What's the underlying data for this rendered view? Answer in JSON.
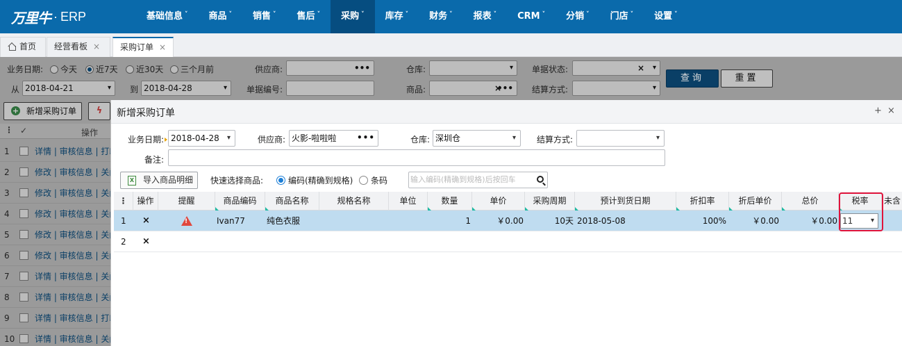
{
  "app": {
    "logo_mark": "万里牛",
    "logo_dot": "·",
    "logo_text": "ERP"
  },
  "nav": [
    {
      "label": "基础信息",
      "active": false
    },
    {
      "label": "商品",
      "active": false
    },
    {
      "label": "销售",
      "active": false
    },
    {
      "label": "售后",
      "active": false
    },
    {
      "label": "采购",
      "active": true
    },
    {
      "label": "库存",
      "active": false
    },
    {
      "label": "财务",
      "active": false
    },
    {
      "label": "报表",
      "active": false
    },
    {
      "label": "CRM",
      "active": false
    },
    {
      "label": "分销",
      "active": false
    },
    {
      "label": "门店",
      "active": false
    },
    {
      "label": "设置",
      "active": false
    }
  ],
  "tabs": {
    "home": "首页",
    "dashboard": "经营看板",
    "purchase_order": "采购订单",
    "close": "×"
  },
  "filter": {
    "biz_date_label": "业务日期:",
    "today": "今天",
    "last7": "近7天",
    "last30": "近30天",
    "last3m": "三个月前",
    "from_label": "从",
    "from_value": "2018-04-21",
    "to_label": "到",
    "to_value": "2018-04-28",
    "supplier_label": "供应商:",
    "doc_no_label": "单据编号:",
    "warehouse_label": "仓库:",
    "product_label": "商品:",
    "status_label": "单据状态:",
    "settle_label": "结算方式:",
    "search_btn": "查询",
    "reset_btn": "重置"
  },
  "bg_list": {
    "new_order_btn": "新增采购订单",
    "ops_header": "操作",
    "rows": [
      {
        "num": "1",
        "ops": "详情 | 审核信息 | 打印"
      },
      {
        "num": "2",
        "ops": "修改 | 审核信息 | 关闭"
      },
      {
        "num": "3",
        "ops": "修改 | 审核信息 | 关闭"
      },
      {
        "num": "4",
        "ops": "修改 | 审核信息 | 关闭"
      },
      {
        "num": "5",
        "ops": "修改 | 审核信息 | 关闭"
      },
      {
        "num": "6",
        "ops": "修改 | 审核信息 | 关闭"
      },
      {
        "num": "7",
        "ops": "详情 | 审核信息 | 关闭"
      },
      {
        "num": "8",
        "ops": "详情 | 审核信息 | 关闭"
      },
      {
        "num": "9",
        "ops": "详情 | 审核信息 | 打印"
      },
      {
        "num": "10",
        "ops": "详情 | 审核信息 | 关闭"
      }
    ]
  },
  "modal": {
    "title": "新增采购订单",
    "ctrl_plus": "+",
    "ctrl_close": "×",
    "biz_date_label": "业务日期:",
    "biz_date_value": "2018-04-28",
    "supplier_label": "供应商:",
    "supplier_value": "火影-啦啦啦",
    "warehouse_label": "仓库:",
    "warehouse_value": "深圳仓",
    "settle_label": "结算方式:",
    "remark_label": "备注:",
    "import_btn": "导入商品明细",
    "quick_label": "快速选择商品:",
    "opt_code": "编码(精确到规格)",
    "opt_barcode": "条码",
    "search_placeholder": "输入编码(精确到规格)后按回车"
  },
  "grid": {
    "headers": {
      "op": "操作",
      "remind": "提醒",
      "code": "商品编码",
      "name": "商品名称",
      "spec": "规格名称",
      "unit": "单位",
      "qty": "数量",
      "price": "单价",
      "cycle": "采购周期",
      "eta": "预计到货日期",
      "discount": "折扣率",
      "disc_price": "折后单价",
      "total": "总价",
      "tax": "税率",
      "untaxed": "未含"
    },
    "rows": [
      {
        "num": "1",
        "del": "×",
        "code": "Ivan77",
        "name": "纯色衣服",
        "qty": "1",
        "price": "￥0.00",
        "cycle": "10天",
        "eta": "2018-05-08",
        "discount": "100%",
        "disc_price": "￥0.00",
        "total": "￥0.00",
        "tax": "11"
      },
      {
        "num": "2",
        "del": "×"
      }
    ]
  },
  "colors": {
    "brand": "#0a6aab",
    "alert": "#e0143c",
    "selected_row": "#bfdcf0"
  }
}
